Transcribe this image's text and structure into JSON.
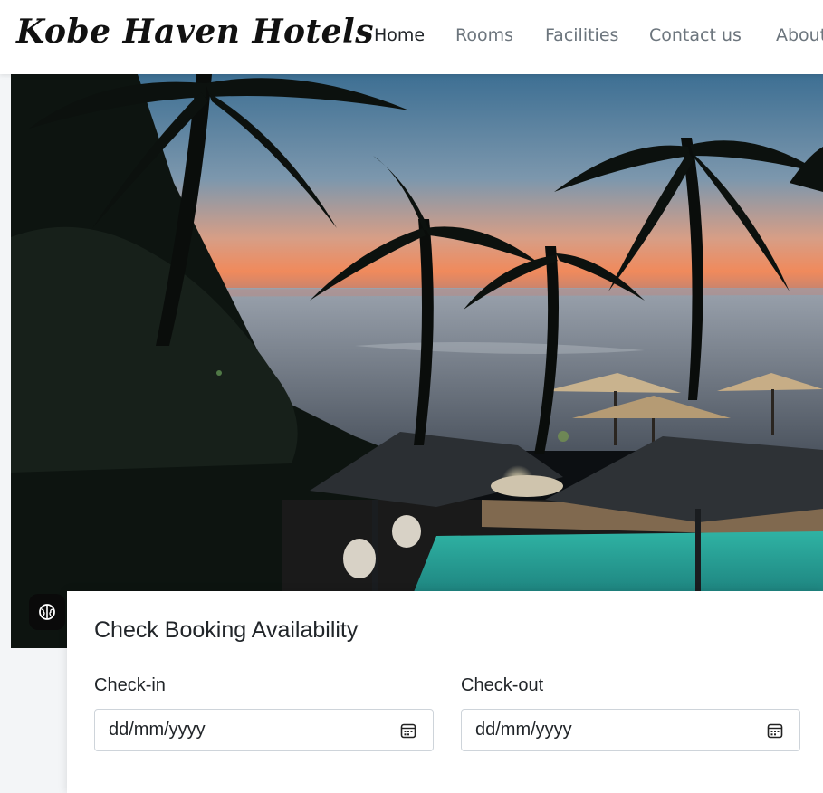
{
  "navbar": {
    "brand": "Kobe Haven Hotels",
    "links": [
      {
        "label": "Home",
        "active": true
      },
      {
        "label": "Rooms",
        "active": false
      },
      {
        "label": "Facilities",
        "active": false
      },
      {
        "label": "Contact us",
        "active": false
      },
      {
        "label": "About",
        "active": false
      }
    ]
  },
  "hero": {
    "image_icon": "tropical-sunset-pool-scene"
  },
  "ai_button": {
    "icon": "brain-icon"
  },
  "booking": {
    "title": "Check Booking Availability",
    "checkin": {
      "label": "Check-in",
      "value": "dd/mm/yyyy",
      "icon": "calendar-icon"
    },
    "checkout": {
      "label": "Check-out",
      "value": "dd/mm/yyyy",
      "icon": "calendar-icon"
    }
  },
  "colors": {
    "nav_active": "#212529",
    "nav_inactive": "#6c757d",
    "card_bg": "#ffffff",
    "page_bg": "#f3f5f7"
  }
}
